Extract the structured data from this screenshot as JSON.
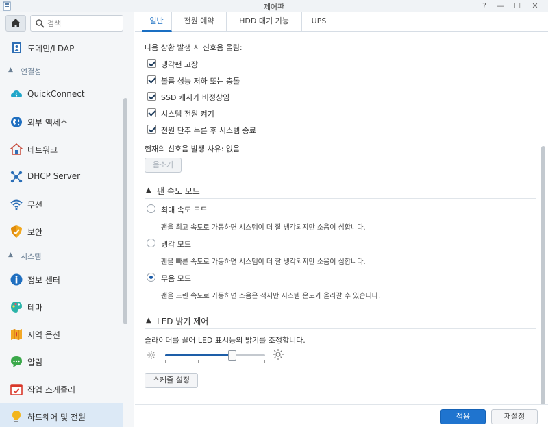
{
  "window": {
    "title": "제어판"
  },
  "sidebar": {
    "search_placeholder": "검색",
    "items": [
      {
        "label": "도메인/LDAP",
        "icon": "address-book-icon"
      },
      {
        "label": "QuickConnect",
        "icon": "quickconnect-icon"
      },
      {
        "label": "외부 액세스",
        "icon": "globe-icon"
      },
      {
        "label": "네트워크",
        "icon": "network-house-icon"
      },
      {
        "label": "DHCP Server",
        "icon": "dhcp-server-icon"
      },
      {
        "label": "무선",
        "icon": "wifi-icon"
      },
      {
        "label": "보안",
        "icon": "shield-icon"
      },
      {
        "label": "정보 센터",
        "icon": "info-icon"
      },
      {
        "label": "테마",
        "icon": "palette-icon"
      },
      {
        "label": "지역 옵션",
        "icon": "map-icon"
      },
      {
        "label": "알림",
        "icon": "chat-bubble-icon"
      },
      {
        "label": "작업 스케줄러",
        "icon": "calendar-check-icon"
      },
      {
        "label": "하드웨어 및 전원",
        "icon": "lightbulb-icon"
      }
    ],
    "sections": [
      "연결성",
      "시스템"
    ],
    "active_index": 12
  },
  "tabs": [
    "일반",
    "전원 예약",
    "HDD 대기 기능",
    "UPS"
  ],
  "active_tab": 0,
  "beep": {
    "heading": "다음 상황 발생 시 신호음 울림:",
    "options": [
      {
        "label": "냉각팬 고장",
        "checked": true
      },
      {
        "label": "볼륨 성능 저하 또는 충돌",
        "checked": true
      },
      {
        "label": "SSD 캐시가 비정상임",
        "checked": true
      },
      {
        "label": "시스템 전원 켜기",
        "checked": true
      },
      {
        "label": "전원 단추 누른 후 시스템 종료",
        "checked": true
      }
    ],
    "current_reason": "현재의 신호음 발생 사유: 없음",
    "mute_button": "음소거"
  },
  "fan": {
    "title": "팬 속도 모드",
    "modes": [
      {
        "label": "최대 속도 모드",
        "desc": "팬을 최고 속도로 가동하면 시스템이 더 잘 냉각되지만 소음이 심합니다.",
        "selected": false
      },
      {
        "label": "냉각 모드",
        "desc": "팬을 빠른 속도로 가동하면 시스템이 더 잘 냉각되지만 소음이 심합니다.",
        "selected": false
      },
      {
        "label": "무음 모드",
        "desc": "팬을 느린 속도로 가동하면 소음은 적지만 시스템 온도가 올라갈 수 있습니다.",
        "selected": true
      }
    ]
  },
  "led": {
    "title": "LED 밝기 제어",
    "desc": "슬라이더를 끌어 LED 표시등의 밝기를 조정합니다.",
    "level": 0.67,
    "schedule_button": "스케줄 설정"
  },
  "footer": {
    "apply": "적용",
    "reset": "재설정"
  },
  "colors": {
    "accent": "#1f74cf",
    "active_nav": "#dce9f6"
  }
}
